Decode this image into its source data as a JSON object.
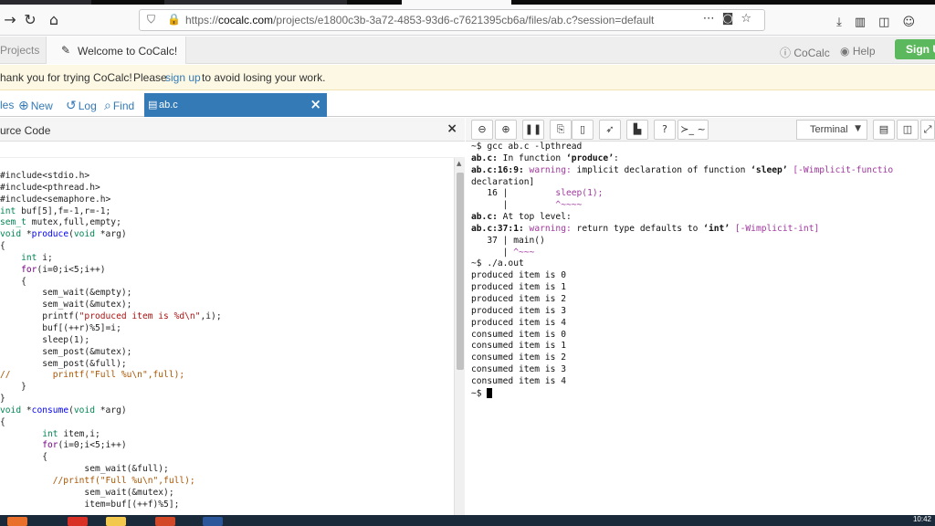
{
  "browser": {
    "url_prefix": "https://",
    "url_host": "cocalc.com",
    "url_path": "/projects/e1800c3b-3a72-4853-93d6-c7621395cb6a/files/ab.c?session=default"
  },
  "cocalc": {
    "projects_tab": "Projects",
    "welcome_tab": "Welcome to CoCalc!",
    "cocalc_link": "CoCalc",
    "help_link": "Help",
    "signup_button": "Sign U"
  },
  "banner": {
    "text_before": "hank you for trying CoCalc!",
    "please": "Please",
    "signup_link": "sign up",
    "text_after": "to avoid losing your work."
  },
  "filetabs": {
    "files": "les",
    "new": "New",
    "log": "Log",
    "find": "Find",
    "active_file": "ab.c"
  },
  "editor": {
    "title": "urce Code",
    "code_lines": [
      "#include<stdio.h>",
      "#include<pthread.h>",
      "#include<semaphore.h>",
      "int buf[5],f=-1,r=-1;",
      "sem_t mutex,full,empty;",
      "void *produce(void *arg)",
      "{",
      "    int i;",
      "    for(i=0;i<5;i++)",
      "    {",
      "        sem_wait(&empty);",
      "        sem_wait(&mutex);",
      "        printf(\"produced item is %d\\n\",i);",
      "        buf[(++r)%5]=i;",
      "        sleep(1);",
      "        sem_post(&mutex);",
      "        sem_post(&full);",
      "//        printf(\"Full %u\\n\",full);",
      "    }",
      "}",
      "void *consume(void *arg)",
      "{",
      "        int item,i;",
      "        for(i=0;i<5;i++)",
      "        {",
      "                sem_wait(&full);",
      "          //printf(\"Full %u\\n\",full);",
      "                sem_wait(&mutex);",
      "                item=buf[(++f)%5];"
    ]
  },
  "terminal": {
    "select_label": "Terminal",
    "lines": [
      "~$ gcc ab.c -lpthread",
      "ab.c: In function ‘produce’:",
      "ab.c:16:9: warning: implicit declaration of function ‘sleep’ [-Wimplicit-functio",
      "declaration]",
      "   16 |         sleep(1);",
      "      |         ^~~~~",
      "ab.c: At top level:",
      "ab.c:37:1: warning: return type defaults to ‘int’ [-Wimplicit-int]",
      "   37 | main()",
      "      | ^~~~",
      "~$ ./a.out",
      "produced item is 0",
      "produced item is 1",
      "produced item is 2",
      "produced item is 3",
      "produced item is 4",
      "consumed item is 0",
      "consumed item is 1",
      "consumed item is 2",
      "consumed item is 3",
      "consumed item is 4",
      "~$ "
    ]
  },
  "taskbar": {
    "clock": "10:42"
  },
  "colors": {
    "accent": "#337ab7",
    "signup": "#5cb85c",
    "banner_bg": "#fcf8e3",
    "warning": "#a0369e"
  }
}
